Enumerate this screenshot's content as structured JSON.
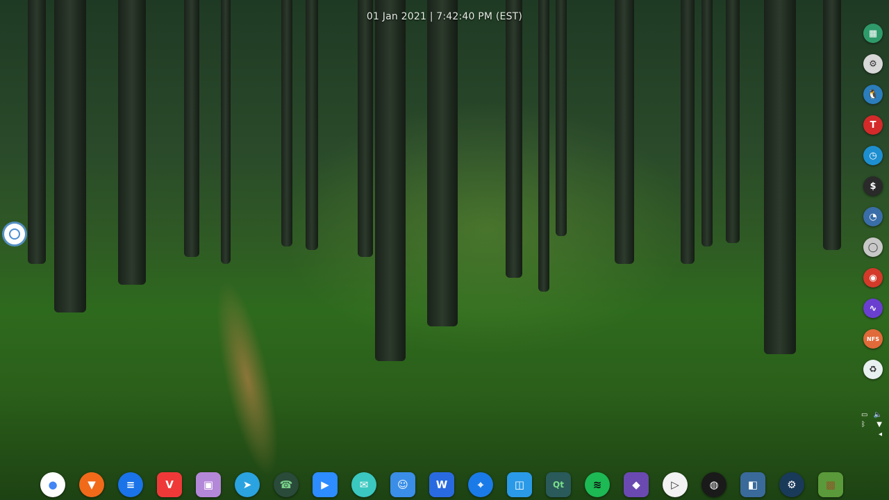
{
  "desktop": {
    "clock_text": "01 Jan 2021 | 7:42:40 PM (EST)"
  },
  "left_launcher": {
    "icon": "app-launcher-icon"
  },
  "right_dock": {
    "items": [
      {
        "name": "cpu-monitor-icon",
        "glyph": "▦",
        "bg": "#2f9a6a"
      },
      {
        "name": "settings-icon",
        "glyph": "⚙",
        "bg": "#d8d8d8"
      },
      {
        "name": "linux-tux-icon",
        "glyph": "🐧",
        "bg": "#2b7dbc"
      },
      {
        "name": "todoist-icon",
        "glyph": "T",
        "bg": "#d42a2a"
      },
      {
        "name": "clock-icon",
        "glyph": "◷",
        "bg": "#1d8fd0"
      },
      {
        "name": "terminal-icon",
        "glyph": "$",
        "bg": "#2a2a2a"
      },
      {
        "name": "speedometer-icon",
        "glyph": "◔",
        "bg": "#3a6ea8"
      },
      {
        "name": "chat-bubble-icon",
        "glyph": "◯",
        "bg": "#c8c8c8"
      },
      {
        "name": "chrome-icon",
        "glyph": "◉",
        "bg": "#d33a2a"
      },
      {
        "name": "audio-wave-icon",
        "glyph": "∿",
        "bg": "#6a3fd0"
      },
      {
        "name": "nfs-folder-icon",
        "glyph": "NFS",
        "bg": "#e06a3a"
      },
      {
        "name": "trash-recycle-icon",
        "glyph": "♻",
        "bg": "#e8f0f0"
      }
    ]
  },
  "tray": {
    "items": [
      {
        "name": "clipboard-icon",
        "glyph": "▭"
      },
      {
        "name": "volume-icon",
        "glyph": "🔈"
      },
      {
        "name": "bluetooth-icon",
        "glyph": "ᛒ"
      },
      {
        "name": "wifi-icon",
        "glyph": "▼"
      },
      {
        "name": "collapse-arrow-icon",
        "glyph": "◂"
      }
    ]
  },
  "dock": {
    "items": [
      {
        "name": "google-assistant-icon",
        "glyph": "●",
        "bg": "#ffffff",
        "fg": "#4285f4",
        "shape": "round"
      },
      {
        "name": "brave-browser-icon",
        "glyph": "▼",
        "bg": "#f06a1a",
        "fg": "#ffffff",
        "shape": "round"
      },
      {
        "name": "messages-icon",
        "glyph": "≡",
        "bg": "#1a73e8",
        "fg": "#ffffff",
        "shape": "round"
      },
      {
        "name": "vivaldi-browser-icon",
        "glyph": "V",
        "bg": "#ef3939",
        "fg": "#ffffff",
        "shape": "square"
      },
      {
        "name": "floppy-save-icon",
        "glyph": "▣",
        "bg": "#b488d8",
        "fg": "#ffffff",
        "shape": "square"
      },
      {
        "name": "telegram-icon",
        "glyph": "➤",
        "bg": "#2aa3e0",
        "fg": "#ffffff",
        "shape": "round"
      },
      {
        "name": "phone-icon",
        "glyph": "☎",
        "bg": "#2a4a3a",
        "fg": "#7ad08a",
        "shape": "round"
      },
      {
        "name": "zoom-icon",
        "glyph": "▶",
        "bg": "#2d8cff",
        "fg": "#ffffff",
        "shape": "square"
      },
      {
        "name": "mail-icon",
        "glyph": "✉",
        "bg": "#3ac8c0",
        "fg": "#ffffff",
        "shape": "round"
      },
      {
        "name": "finder-icon",
        "glyph": "☺",
        "bg": "#3a8ee8",
        "fg": "#ffffff",
        "shape": "square"
      },
      {
        "name": "wps-office-icon",
        "glyph": "W",
        "bg": "#2a6ae0",
        "fg": "#ffffff",
        "shape": "square"
      },
      {
        "name": "telescope-icon",
        "glyph": "⌖",
        "bg": "#1a7ae8",
        "fg": "#ffffff",
        "shape": "round"
      },
      {
        "name": "app-store-bag-icon",
        "glyph": "◫",
        "bg": "#2a9ae8",
        "fg": "#ffffff",
        "shape": "square"
      },
      {
        "name": "qt-creator-icon",
        "glyph": "Qt",
        "bg": "#2a5a5a",
        "fg": "#7ae08a",
        "shape": "square"
      },
      {
        "name": "spotify-icon",
        "glyph": "≋",
        "bg": "#1db954",
        "fg": "#111111",
        "shape": "round"
      },
      {
        "name": "kdenlive-icon",
        "glyph": "◆",
        "bg": "#6a4ab0",
        "fg": "#ffffff",
        "shape": "square"
      },
      {
        "name": "media-player-icon",
        "glyph": "▷",
        "bg": "#f2f2f2",
        "fg": "#333333",
        "shape": "round"
      },
      {
        "name": "obs-studio-icon",
        "glyph": "◍",
        "bg": "#1a1a1a",
        "fg": "#ffffff",
        "shape": "round"
      },
      {
        "name": "split-view-icon",
        "glyph": "◧",
        "bg": "#3a6a9a",
        "fg": "#ffffff",
        "shape": "square"
      },
      {
        "name": "steam-icon",
        "glyph": "⚙",
        "bg": "#1a3a5a",
        "fg": "#ffffff",
        "shape": "round"
      },
      {
        "name": "minecraft-icon",
        "glyph": "▩",
        "bg": "#5a9a3a",
        "fg": "#8a5a2a",
        "shape": "square"
      }
    ]
  }
}
